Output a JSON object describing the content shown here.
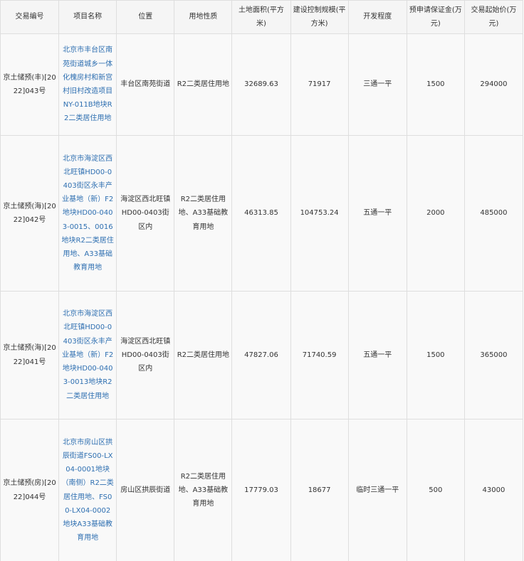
{
  "headers": {
    "trade_no": "交易编号",
    "project_name": "项目名称",
    "location": "位置",
    "land_use": "用地性质",
    "area": "土地面积(平方米)",
    "building_scale": "建设控制规模(平方米)",
    "development": "开发程度",
    "deposit": "预申请保证金(万元)",
    "start_price": "交易起始价(万元)"
  },
  "rows": [
    {
      "trade_no": "京土储预(丰)[2022]043号",
      "project_name": "北京市丰台区南苑街道城乡一体化槐房村和新宫村旧村改造项目NY-011B地块R2二类居住用地",
      "location": "丰台区南苑街道",
      "land_use": "R2二类居住用地",
      "area": "32689.63",
      "building_scale": "71917",
      "development": "三通一平",
      "deposit": "1500",
      "start_price": "294000"
    },
    {
      "trade_no": "京土储预(海)[2022]042号",
      "project_name": "北京市海淀区西北旺镇HD00-0403街区永丰产业基地（新）F2地块HD00-0403-0015、0016地块R2二类居住用地、A33基础教育用地",
      "location": "海淀区西北旺镇HD00-0403街区内",
      "land_use": "R2二类居住用地、A33基础教育用地",
      "area": "46313.85",
      "building_scale": "104753.24",
      "development": "五通一平",
      "deposit": "2000",
      "start_price": "485000"
    },
    {
      "trade_no": "京土储预(海)[2022]041号",
      "project_name": "北京市海淀区西北旺镇HD00-0403街区永丰产业基地（新）F2地块HD00-0403-0013地块R2二类居住用地",
      "location": "海淀区西北旺镇HD00-0403街区内",
      "land_use": "R2二类居住用地",
      "area": "47827.06",
      "building_scale": "71740.59",
      "development": "五通一平",
      "deposit": "1500",
      "start_price": "365000"
    },
    {
      "trade_no": "京土储预(房)[2022]044号",
      "project_name": "北京市房山区拱辰街道FS00-LX04-0001地块（南侧）R2二类居住用地、FS00-LX04-0002地块A33基础教育用地",
      "location": "房山区拱辰街道",
      "land_use": "R2二类居住用地、A33基础教育用地",
      "area": "17779.03",
      "building_scale": "18677",
      "development": "临时三通一平",
      "deposit": "500",
      "start_price": "43000"
    }
  ]
}
